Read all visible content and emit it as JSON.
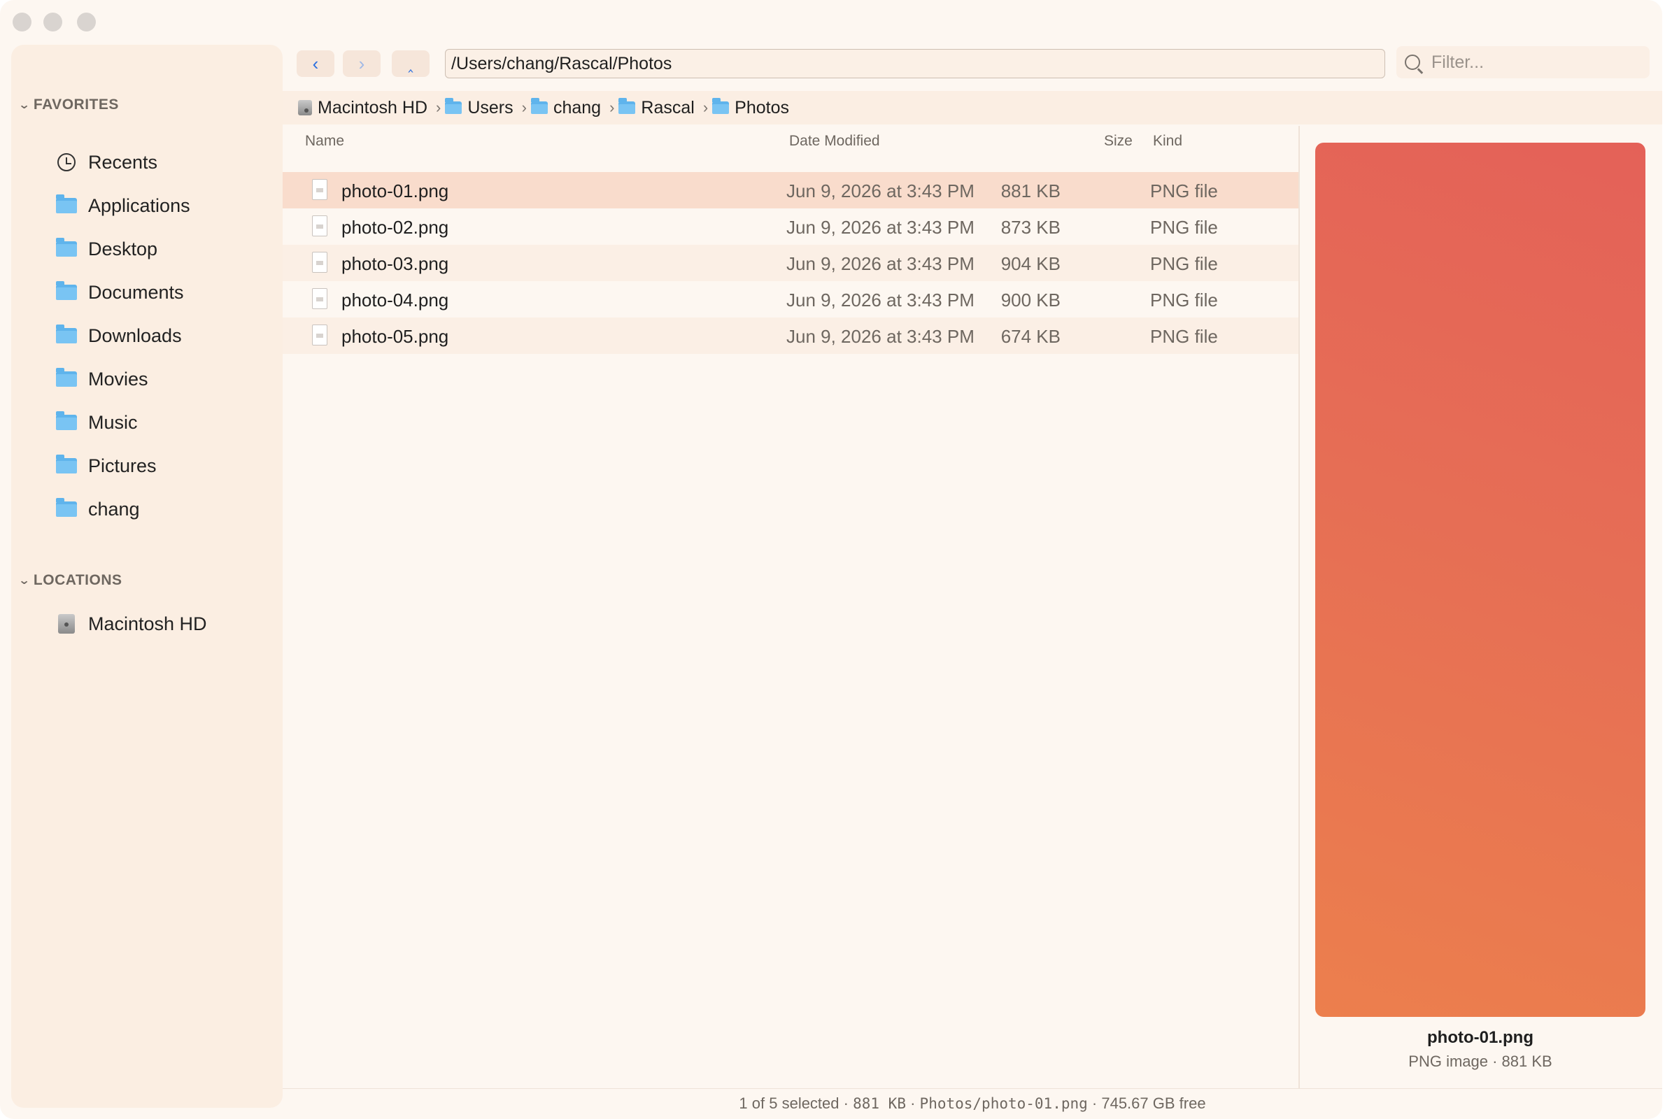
{
  "sidebar": {
    "favorites_heading": "FAVORITES",
    "favorites": [
      {
        "label": "Recents",
        "icon": "clock-icon"
      },
      {
        "label": "Applications",
        "icon": "folder-icon"
      },
      {
        "label": "Desktop",
        "icon": "folder-icon"
      },
      {
        "label": "Documents",
        "icon": "folder-icon"
      },
      {
        "label": "Downloads",
        "icon": "folder-icon"
      },
      {
        "label": "Movies",
        "icon": "folder-icon"
      },
      {
        "label": "Music",
        "icon": "folder-icon"
      },
      {
        "label": "Pictures",
        "icon": "folder-icon"
      },
      {
        "label": "chang",
        "icon": "home-folder-icon"
      }
    ],
    "locations_heading": "LOCATIONS",
    "locations": [
      {
        "label": "Macintosh HD",
        "icon": "disk-icon"
      }
    ]
  },
  "toolbar": {
    "back_icon": "chevron-left-icon",
    "forward_icon": "chevron-right-icon",
    "up_icon": "chevron-up-icon",
    "path": "/Users/chang/Rascal/Photos",
    "filter_placeholder": "Filter..."
  },
  "breadcrumb": [
    "Macintosh HD",
    "Users",
    "chang",
    "Rascal",
    "Photos"
  ],
  "columns": {
    "name": "Name",
    "date": "Date Modified",
    "size": "Size",
    "kind": "Kind"
  },
  "files": [
    {
      "name": "photo-01.png",
      "date": "Jun 9, 2026 at 3:43 PM",
      "size": "881 KB",
      "kind": "PNG file",
      "selected": true
    },
    {
      "name": "photo-02.png",
      "date": "Jun 9, 2026 at 3:43 PM",
      "size": "873 KB",
      "kind": "PNG file",
      "selected": false
    },
    {
      "name": "photo-03.png",
      "date": "Jun 9, 2026 at 3:43 PM",
      "size": "904 KB",
      "kind": "PNG file",
      "selected": false
    },
    {
      "name": "photo-04.png",
      "date": "Jun 9, 2026 at 3:43 PM",
      "size": "900 KB",
      "kind": "PNG file",
      "selected": false
    },
    {
      "name": "photo-05.png",
      "date": "Jun 9, 2026 at 3:43 PM",
      "size": "674 KB",
      "kind": "PNG file",
      "selected": false
    }
  ],
  "preview": {
    "name": "photo-01.png",
    "meta": "PNG image · 881 KB",
    "gradient_colors": [
      "#e46158",
      "#ec7f4d"
    ]
  },
  "status": {
    "selected": "1 of 5 selected",
    "size": "881 KB",
    "path": "Photos/photo-01.png",
    "free": "745.67 GB free"
  },
  "colors": {
    "window_bg": "#fdf7f1",
    "sidebar_bg": "#fbeee2",
    "selection": "#f9dccc",
    "accent": "#2b6fe0",
    "folder": "#5fb4ec"
  }
}
